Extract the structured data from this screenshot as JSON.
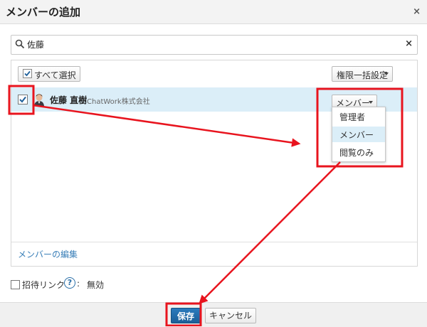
{
  "dialog": {
    "title": "メンバーの追加",
    "close_glyph": "×"
  },
  "search": {
    "value": "佐藤",
    "clear_glyph": "×"
  },
  "toolbar": {
    "select_all_label": "すべて選択",
    "bulk_role_label": "権限一括設定"
  },
  "members": [
    {
      "name": "佐藤 直樹",
      "org": "ChatWork株式会社",
      "role": "メンバー",
      "checked": true
    }
  ],
  "role_menu": {
    "options": [
      "管理者",
      "メンバー",
      "閲覧のみ"
    ],
    "selected": "メンバー"
  },
  "edit_members_link": "メンバーの編集",
  "invite": {
    "label": "招待リンク",
    "help_glyph": "?",
    "colon": ":",
    "state": "無効"
  },
  "footer": {
    "save_label": "保存",
    "cancel_label": "キャンセル"
  },
  "colors": {
    "accent": "#1c5f98",
    "selection": "#dbeef8",
    "annotation": "#e8141e",
    "link": "#3a7fb8"
  }
}
